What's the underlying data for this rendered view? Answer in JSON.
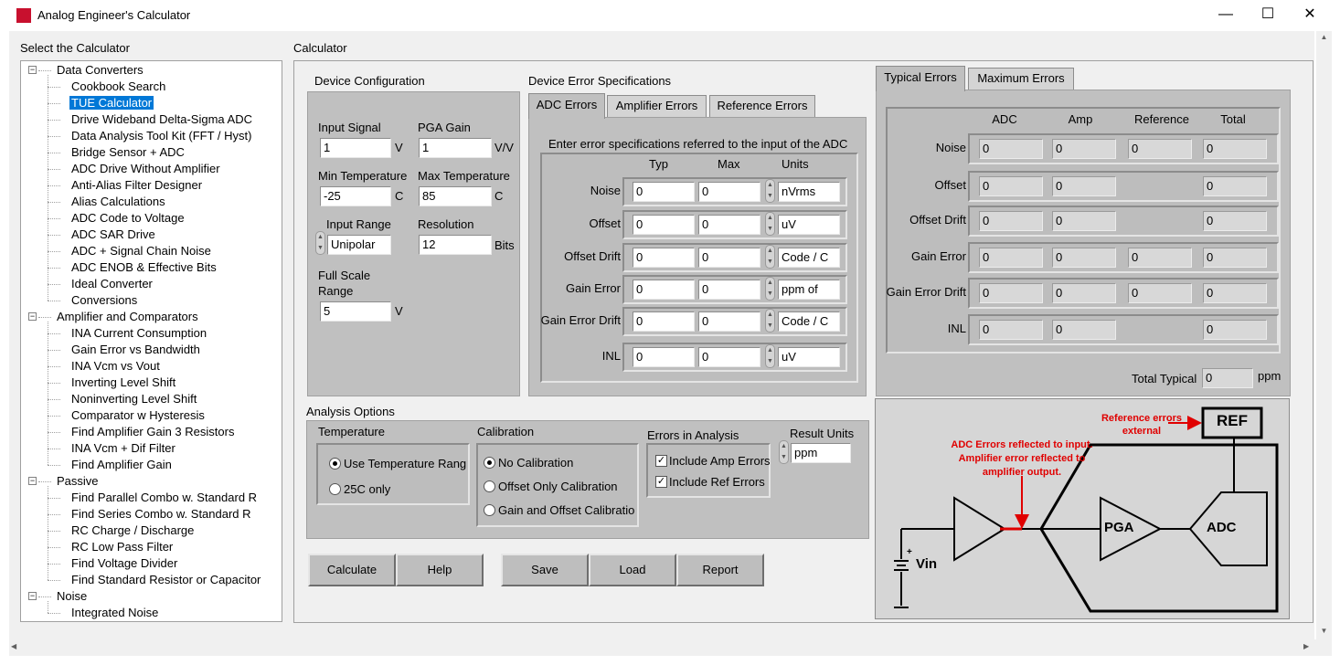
{
  "window": {
    "title": "Analog Engineer's Calculator",
    "minimize_glyph": "—",
    "maximize_glyph": "☐",
    "close_glyph": "✕"
  },
  "sidebar": {
    "title": "Select the Calculator",
    "categories": [
      {
        "label": "Data Converters",
        "items": [
          "Cookbook Search",
          "TUE Calculator",
          "Drive Wideband Delta-Sigma ADC",
          "Data Analysis Tool Kit (FFT / Hyst)",
          "Bridge Sensor + ADC",
          "ADC Drive Without Amplifier",
          "Anti-Alias Filter Designer",
          "Alias Calculations",
          "ADC Code to Voltage",
          "ADC SAR Drive",
          "ADC + Signal Chain Noise",
          "ADC ENOB & Effective Bits",
          "Ideal Converter",
          "Conversions"
        ]
      },
      {
        "label": "Amplifier and Comparators",
        "items": [
          "INA Current Consumption",
          "Gain Error vs Bandwidth",
          "INA Vcm vs Vout",
          "Inverting Level Shift",
          "Noninverting Level Shift",
          "Comparator w Hysteresis",
          "Find Amplifier Gain 3 Resistors",
          "INA Vcm + Dif Filter",
          "Find Amplifier Gain"
        ]
      },
      {
        "label": "Passive",
        "items": [
          "Find Parallel Combo w. Standard R",
          "Find Series Combo w. Standard R",
          "RC Charge / Discharge",
          "RC Low Pass Filter",
          "Find Voltage Divider",
          "Find Standard Resistor or Capacitor"
        ]
      },
      {
        "label": "Noise",
        "items": [
          "Integrated Noise"
        ]
      }
    ],
    "selected": "TUE Calculator"
  },
  "calculator_label": "Calculator",
  "device_config": {
    "title": "Device Configuration",
    "input_signal_label": "Input Signal",
    "input_signal": "1",
    "input_signal_unit": "V",
    "pga_gain_label": "PGA Gain",
    "pga_gain": "1",
    "pga_gain_unit": "V/V",
    "min_temp_label": "Min Temperature",
    "min_temp": "-25",
    "min_temp_unit": "C",
    "max_temp_label": "Max Temperature",
    "max_temp": "85",
    "max_temp_unit": "C",
    "input_range_label": "Input Range",
    "input_range": "Unipolar",
    "resolution_label": "Resolution",
    "resolution": "12",
    "resolution_unit": "Bits",
    "fsr_label_1": "Full Scale",
    "fsr_label_2": "Range",
    "fsr": "5",
    "fsr_unit": "V"
  },
  "error_specs": {
    "title": "Device Error Specifications",
    "tabs": [
      "ADC Errors",
      "Amplifier Errors",
      "Reference Errors"
    ],
    "active_tab": "ADC Errors",
    "instruction": "Enter error specifications referred to the input of the ADC",
    "headers": {
      "typ": "Typ",
      "max": "Max",
      "units": "Units"
    },
    "rows": [
      {
        "label": "Noise",
        "typ": "0",
        "max": "0",
        "units": "nVrms"
      },
      {
        "label": "Offset",
        "typ": "0",
        "max": "0",
        "units": "uV"
      },
      {
        "label": "Offset Drift",
        "typ": "0",
        "max": "0",
        "units": "Code / C"
      },
      {
        "label": "Gain Error",
        "typ": "0",
        "max": "0",
        "units": "ppm of"
      },
      {
        "label": "Gain Error Drift",
        "typ": "0",
        "max": "0",
        "units": "Code / C"
      },
      {
        "label": "INL",
        "typ": "0",
        "max": "0",
        "units": "uV"
      }
    ]
  },
  "results": {
    "tabs": [
      "Typical Errors",
      "Maximum Errors"
    ],
    "active_tab": "Typical Errors",
    "headers": {
      "adc": "ADC",
      "amp": "Amp",
      "reference": "Reference",
      "total": "Total"
    },
    "rows": [
      {
        "label": "Noise",
        "adc": "0",
        "amp": "0",
        "reference": "0",
        "total": "0"
      },
      {
        "label": "Offset",
        "adc": "0",
        "amp": "0",
        "reference": null,
        "total": "0"
      },
      {
        "label": "Offset Drift",
        "adc": "0",
        "amp": "0",
        "reference": null,
        "total": "0"
      },
      {
        "label": "Gain Error",
        "adc": "0",
        "amp": "0",
        "reference": "0",
        "total": "0"
      },
      {
        "label": "Gain Error Drift",
        "adc": "0",
        "amp": "0",
        "reference": "0",
        "total": "0"
      },
      {
        "label": "INL",
        "adc": "0",
        "amp": "0",
        "reference": null,
        "total": "0"
      }
    ],
    "total_typical_label": "Total Typical",
    "total_typical": "0",
    "total_typical_unit": "ppm"
  },
  "analysis": {
    "title": "Analysis Options",
    "temperature_label": "Temperature",
    "temp_options": [
      "Use Temperature Rang",
      "25C only"
    ],
    "temp_selected": 0,
    "calibration_label": "Calibration",
    "cal_options": [
      "No Calibration",
      "Offset Only Calibration",
      "Gain and Offset Calibratio"
    ],
    "cal_selected": 0,
    "errors_label": "Errors in Analysis",
    "include_amp": "Include Amp Errors",
    "include_ref": "Include Ref Errors",
    "check_glyph": "✓",
    "result_units_label": "Result Units",
    "result_units": "ppm"
  },
  "buttons": {
    "calculate": "Calculate",
    "help": "Help",
    "save": "Save",
    "load": "Load",
    "report": "Report"
  },
  "diagram": {
    "ref_label": "REF",
    "pga_label": "PGA",
    "adc_label": "ADC",
    "vin_label": "Vin",
    "plus_label": "+",
    "ref_note_1": "Reference errors",
    "ref_note_2": "external",
    "adc_note_1": "ADC Errors reflected to input.",
    "adc_note_2": "Amplifier error reflected to",
    "adc_note_3": "amplifier output.",
    "note_color": "#e00000"
  }
}
